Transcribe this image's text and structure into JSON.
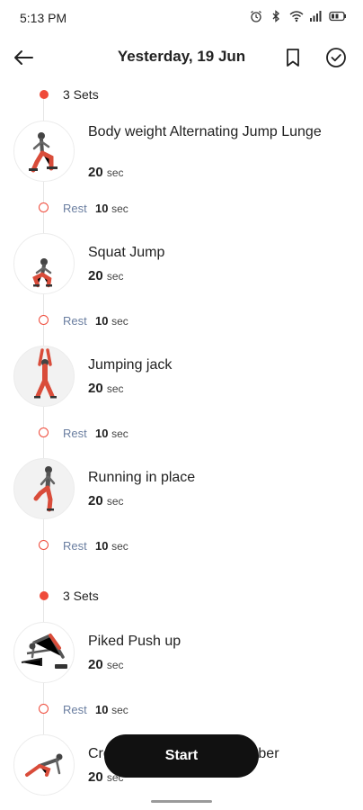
{
  "status_bar": {
    "time": "5:13 PM",
    "icons": [
      "alarm-icon",
      "bluetooth-icon",
      "wifi-icon",
      "signal-icon",
      "battery-icon"
    ]
  },
  "app_bar": {
    "title": "Yesterday, 19 Jun",
    "icons": [
      "back-arrow-icon",
      "bookmark-icon",
      "check-circle-icon"
    ]
  },
  "accent_color": "#ef4a3a",
  "groups": [
    {
      "sets_label": "3 Sets",
      "exercises": [
        {
          "name": "Body weight Alternating Jump Lunge",
          "duration": "20",
          "unit": "sec",
          "rest_label": "Rest",
          "rest_value": "10",
          "rest_unit": "sec"
        },
        {
          "name": "Squat Jump",
          "duration": "20",
          "unit": "sec",
          "rest_label": "Rest",
          "rest_value": "10",
          "rest_unit": "sec"
        },
        {
          "name": "Jumping jack",
          "duration": "20",
          "unit": "sec",
          "rest_label": "Rest",
          "rest_value": "10",
          "rest_unit": "sec"
        },
        {
          "name": "Running in place",
          "duration": "20",
          "unit": "sec",
          "rest_label": "Rest",
          "rest_value": "10",
          "rest_unit": "sec"
        }
      ]
    },
    {
      "sets_label": "3 Sets",
      "exercises": [
        {
          "name": "Piked Push up",
          "duration": "20",
          "unit": "sec",
          "rest_label": "Rest",
          "rest_value": "10",
          "rest_unit": "sec"
        },
        {
          "name": "Cross Body Mountain Climber",
          "duration": "20",
          "unit": "sec"
        }
      ]
    }
  ],
  "start_button": {
    "label": "Start"
  }
}
